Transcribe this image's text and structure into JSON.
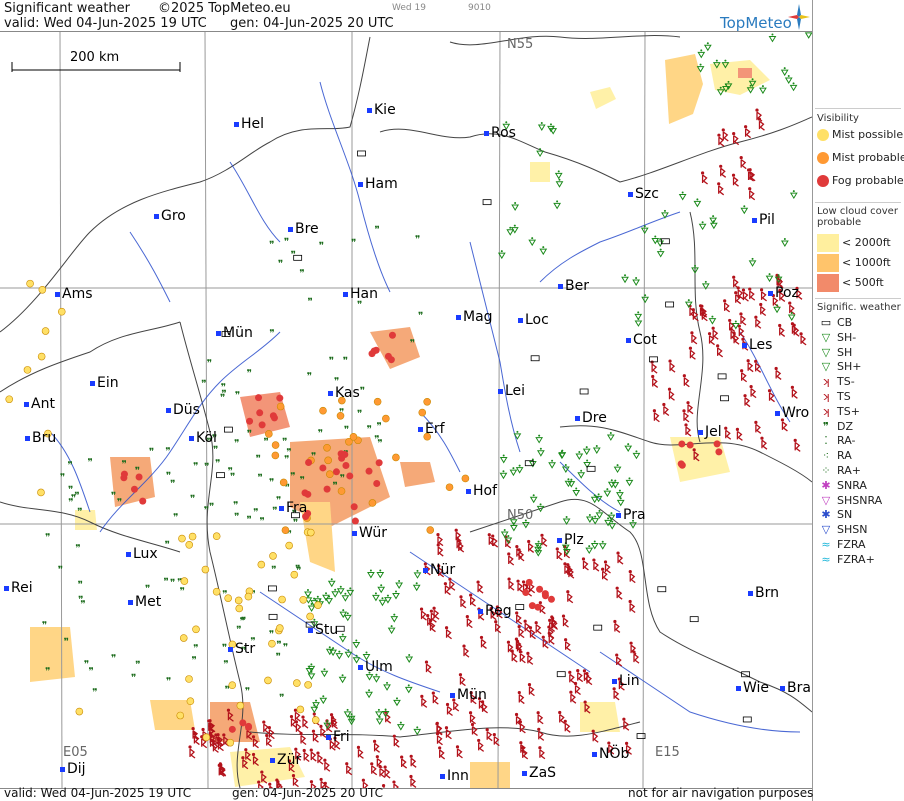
{
  "header": {
    "title": "Significant weather",
    "copyright": "©2025 TopMeteo.eu",
    "small_day": "Wed 19",
    "small_code": "9010",
    "valid": "valid:  Wed  04-Jun-2025  19 UTC",
    "gen": "gen: 04-Jun-2025 20 UTC",
    "brand": "TopMeteo"
  },
  "scale": {
    "label": "200 km"
  },
  "grid_labels": {
    "n55": "N55",
    "n50": "N50",
    "e05": "E05",
    "e15": "E15"
  },
  "cities": [
    {
      "name": "Kie"
    },
    {
      "name": "Hel"
    },
    {
      "name": "Ros"
    },
    {
      "name": "Ham"
    },
    {
      "name": "Szc"
    },
    {
      "name": "Gro"
    },
    {
      "name": "Bre"
    },
    {
      "name": "Pil"
    },
    {
      "name": "Ber"
    },
    {
      "name": "Ams"
    },
    {
      "name": "Han"
    },
    {
      "name": "Poz"
    },
    {
      "name": "Mag"
    },
    {
      "name": "Loc"
    },
    {
      "name": "Mün"
    },
    {
      "name": "Cot"
    },
    {
      "name": "Les"
    },
    {
      "name": "Ein"
    },
    {
      "name": "Kas"
    },
    {
      "name": "Lei"
    },
    {
      "name": "Ant"
    },
    {
      "name": "Düs"
    },
    {
      "name": "Dre"
    },
    {
      "name": "Wro"
    },
    {
      "name": "Erf"
    },
    {
      "name": "Bru"
    },
    {
      "name": "Köl"
    },
    {
      "name": "Jel"
    },
    {
      "name": "Hof"
    },
    {
      "name": "Fra"
    },
    {
      "name": "Pra"
    },
    {
      "name": "Wür"
    },
    {
      "name": "Plz"
    },
    {
      "name": "Lux"
    },
    {
      "name": "Rei"
    },
    {
      "name": "Nür"
    },
    {
      "name": "Met"
    },
    {
      "name": "Brn"
    },
    {
      "name": "Reg"
    },
    {
      "name": "Stu"
    },
    {
      "name": "Str"
    },
    {
      "name": "Ulm"
    },
    {
      "name": "Lin"
    },
    {
      "name": "Mün"
    },
    {
      "name": "Wie"
    },
    {
      "name": "Bra"
    },
    {
      "name": "Fri"
    },
    {
      "name": "NÖb"
    },
    {
      "name": "Zür"
    },
    {
      "name": "Dij"
    },
    {
      "name": "Inn"
    },
    {
      "name": "ZaS"
    }
  ],
  "legend": {
    "visibility_title": "Visibility",
    "visibility": [
      {
        "label": "Mist possible",
        "color": "#ffe066"
      },
      {
        "label": "Mist probable",
        "color": "#ff9933"
      },
      {
        "label": "Fog probable",
        "color": "#e03a3a"
      }
    ],
    "lowcloud_title": "Low cloud cover probable",
    "lowcloud": [
      {
        "label": "< 2000ft",
        "color": "#ffef9e"
      },
      {
        "label": "< 1000ft",
        "color": "#ffc46b"
      },
      {
        "label": "<   500ft",
        "color": "#f28a6a"
      }
    ],
    "sigwx_title": "Signific. weather",
    "sigwx": [
      {
        "label": "CB",
        "icon": "cb-icon"
      },
      {
        "label": "SH-",
        "icon": "shower-light-icon"
      },
      {
        "label": "SH",
        "icon": "shower-icon"
      },
      {
        "label": "SH+",
        "icon": "shower-heavy-icon"
      },
      {
        "label": "TS-",
        "icon": "thunder-light-icon"
      },
      {
        "label": "TS",
        "icon": "thunder-icon"
      },
      {
        "label": "TS+",
        "icon": "thunder-heavy-icon"
      },
      {
        "label": "DZ",
        "icon": "drizzle-icon"
      },
      {
        "label": "RA-",
        "icon": "rain-light-icon"
      },
      {
        "label": "RA",
        "icon": "rain-icon"
      },
      {
        "label": "RA+",
        "icon": "rain-heavy-icon"
      },
      {
        "label": "SNRA",
        "icon": "sleet-icon"
      },
      {
        "label": "SHSNRA",
        "icon": "sleet-shower-icon"
      },
      {
        "label": "SN",
        "icon": "snow-icon"
      },
      {
        "label": "SHSN",
        "icon": "snow-shower-icon"
      },
      {
        "label": "FZRA",
        "icon": "freezing-rain-icon"
      },
      {
        "label": "FZRA+",
        "icon": "freezing-rain-heavy-icon"
      }
    ]
  },
  "footer": {
    "valid": "valid:  Wed  04-Jun-2025  19 UTC",
    "gen": "gen: 04-Jun-2025 20 UTC",
    "note": "not for air navigation purposes"
  }
}
